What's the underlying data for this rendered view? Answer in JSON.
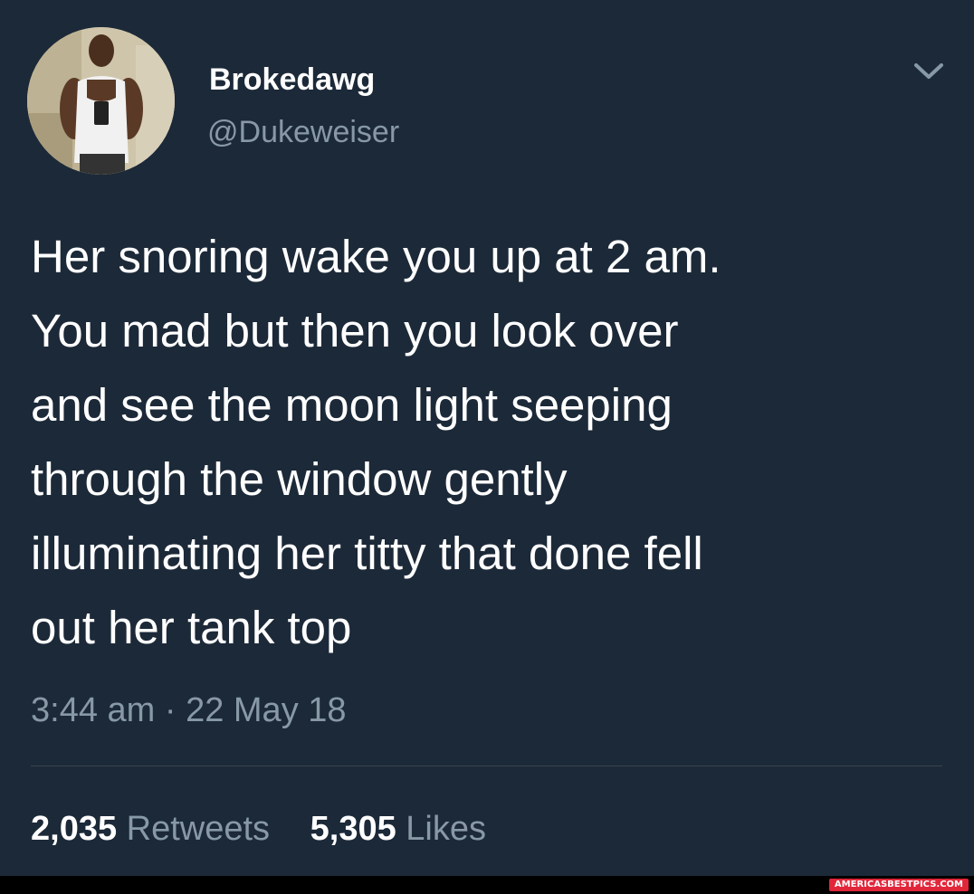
{
  "tweet": {
    "author": {
      "display_name": "Brokedawg",
      "handle": "@Dukeweiser",
      "avatar_icon": "profile-photo"
    },
    "menu_icon": "chevron-down-icon",
    "text_lines": [
      "Her snoring wake you up at 2 am.",
      "You mad but then you look over",
      "and see the moon light seeping",
      "through the window gently",
      "illuminating her titty that done fell",
      "out her tank top"
    ],
    "timestamp": "3:44 am · 22 May 18",
    "stats": {
      "retweets_count": "2,035",
      "retweets_label": "Retweets",
      "likes_count": "5,305",
      "likes_label": "Likes"
    }
  },
  "watermark": "AMERICASBESTPICS.COM",
  "colors": {
    "background": "#1c2938",
    "primary_text": "#ffffff",
    "secondary_text": "#8899a6",
    "divider": "#38444d",
    "watermark_bg": "#e2263a"
  }
}
